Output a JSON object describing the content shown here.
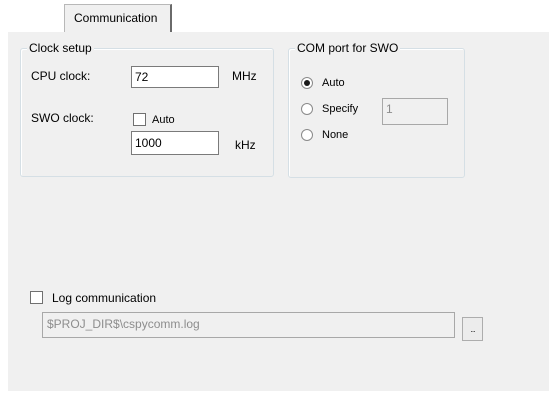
{
  "tab": {
    "label": "Communication"
  },
  "clock_setup": {
    "title": "Clock setup",
    "cpu_clock_label": "CPU clock:",
    "cpu_clock_value": "72",
    "cpu_clock_unit": "MHz",
    "swo_clock_label": "SWO clock:",
    "swo_auto_label": "Auto",
    "swo_auto_checked": false,
    "swo_clock_value": "1000",
    "swo_clock_unit": "kHz"
  },
  "com_port": {
    "title": "COM port for SWO",
    "auto_label": "Auto",
    "specify_label": "Specify",
    "specify_value": "1",
    "none_label": "None",
    "selected": "Auto"
  },
  "log": {
    "label": "Log communication",
    "checked": false,
    "path_value": "$PROJ_DIR$\\cspycomm.log",
    "browse_label": "..."
  }
}
